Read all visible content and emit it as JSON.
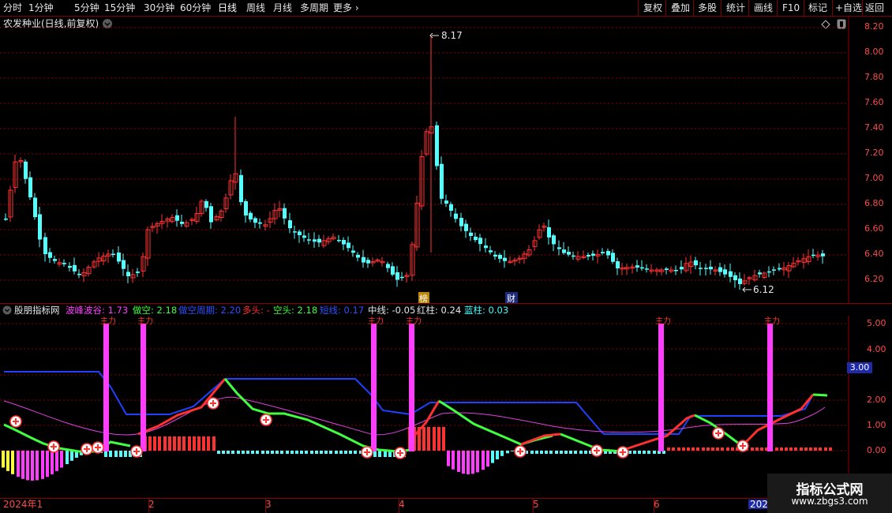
{
  "toolbar": {
    "periods": [
      "分时",
      "1分钟",
      "5分钟",
      "15分钟",
      "30分钟",
      "60分钟",
      "日线",
      "周线",
      "月线",
      "多周期",
      "更多"
    ],
    "more_chevron": "›",
    "actions": [
      "复权",
      "叠加",
      "多股",
      "统计",
      "画线",
      "F10",
      "标记",
      "+自选",
      "返回"
    ]
  },
  "main": {
    "title": "农发种业(日线,前复权)",
    "y_ticks": [
      "8.20",
      "8.00",
      "7.80",
      "7.60",
      "7.40",
      "7.20",
      "7.00",
      "6.80",
      "6.60",
      "6.40",
      "6.20"
    ],
    "high_label": "8.17",
    "low_label": "6.12",
    "marker_bang": "榜",
    "marker_cai": "财"
  },
  "indicator": {
    "name": "股朋指标网",
    "legend": [
      {
        "label": "波峰波谷:",
        "value": "1.73",
        "color": "#ff3dff"
      },
      {
        "label": "做空:",
        "value": "2.18",
        "color": "#40ff40"
      },
      {
        "label": "做空周期:",
        "value": "2.20",
        "color": "#3050ff"
      },
      {
        "label": "多头:",
        "value": "-",
        "color": "#ff3030"
      },
      {
        "label": "空头:",
        "value": "2.18",
        "color": "#40ff40"
      },
      {
        "label": "短线:",
        "value": "0.17",
        "color": "#3050ff"
      },
      {
        "label": "中线:",
        "value": "-0.05",
        "color": "#e6e6e6"
      },
      {
        "label": "红柱:",
        "value": "0.24",
        "color": "#e6e6e6"
      },
      {
        "label": "蓝柱:",
        "value": "0.03",
        "color": "#40ffff"
      }
    ],
    "y_ticks": [
      "5.00",
      "4.00",
      "3.00",
      "2.00",
      "1.00",
      "0.00"
    ],
    "current_value": "3.00",
    "signal_label": "主力"
  },
  "x_axis": {
    "labels": [
      "2024年1",
      "2",
      "3",
      "4",
      "5",
      "6",
      "202"
    ]
  },
  "watermark": {
    "line1": "指标公式网",
    "line2": "www.zbgs3.com"
  },
  "colors": {
    "up": "#ff3232",
    "down": "#54ffff",
    "grid": "#8b0000",
    "axis_text": "#ff4a4a",
    "magenta": "#ff3dff"
  }
}
